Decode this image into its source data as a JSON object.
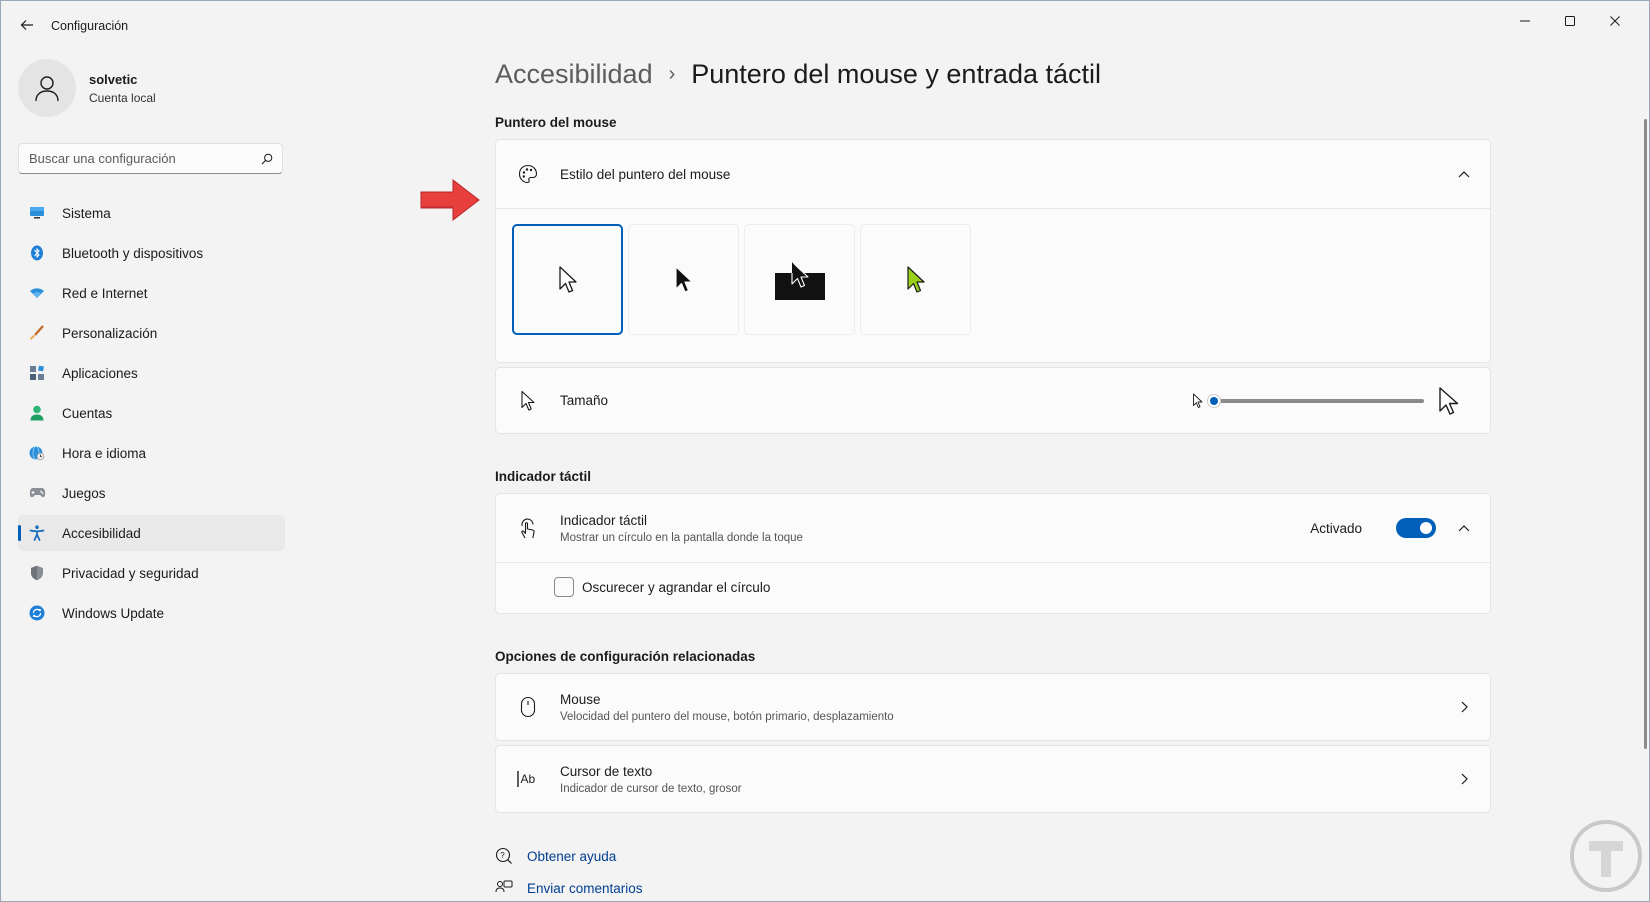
{
  "window": {
    "app_title": "Configuración",
    "icons": {
      "back": "back-arrow-icon",
      "minimize": "minimize-icon",
      "maximize": "maximize-icon",
      "close": "close-icon"
    }
  },
  "profile": {
    "name": "solvetic",
    "account": "Cuenta local",
    "icon": "user-avatar-icon"
  },
  "search": {
    "placeholder": "Buscar una configuración",
    "value": ""
  },
  "sidebar": {
    "items": [
      {
        "label": "Sistema",
        "icon": "monitor-icon",
        "active": false
      },
      {
        "label": "Bluetooth y dispositivos",
        "icon": "bluetooth-icon",
        "active": false
      },
      {
        "label": "Red e Internet",
        "icon": "wifi-icon",
        "active": false
      },
      {
        "label": "Personalización",
        "icon": "brush-icon",
        "active": false
      },
      {
        "label": "Aplicaciones",
        "icon": "apps-icon",
        "active": false
      },
      {
        "label": "Cuentas",
        "icon": "person-icon",
        "active": false
      },
      {
        "label": "Hora e idioma",
        "icon": "globe-clock-icon",
        "active": false
      },
      {
        "label": "Juegos",
        "icon": "gamepad-icon",
        "active": false
      },
      {
        "label": "Accesibilidad",
        "icon": "accessibility-icon",
        "active": true
      },
      {
        "label": "Privacidad y seguridad",
        "icon": "shield-icon",
        "active": false
      },
      {
        "label": "Windows Update",
        "icon": "update-icon",
        "active": false
      }
    ]
  },
  "breadcrumb": {
    "parent": "Accesibilidad",
    "separator": "›",
    "current": "Puntero del mouse y entrada táctil"
  },
  "mouse_pointer": {
    "section_title": "Puntero del mouse",
    "style": {
      "title": "Estilo del puntero del mouse",
      "icon": "palette-icon",
      "options": [
        "white",
        "black",
        "inverted",
        "custom"
      ],
      "selected": "white",
      "custom_color": "#9cd11a"
    },
    "size": {
      "title": "Tamaño",
      "icon": "pointer-icon",
      "level": 0
    }
  },
  "touch": {
    "section_title": "Indicador táctil",
    "title": "Indicador táctil",
    "subtitle": "Mostrar un círculo en la pantalla donde la toque",
    "icon": "touch-icon",
    "state_label": "Activado",
    "enabled": true,
    "checkbox_label": "Oscurecer y agrandar el círculo",
    "checkbox_checked": false
  },
  "related": {
    "section_title": "Opciones de configuración relacionadas",
    "items": [
      {
        "title": "Mouse",
        "subtitle": "Velocidad del puntero del mouse, botón primario, desplazamiento",
        "icon": "mouse-icon"
      },
      {
        "title": "Cursor de texto",
        "subtitle": "Indicador de cursor de texto, grosor",
        "icon": "text-cursor-icon"
      }
    ]
  },
  "footer": {
    "help": "Obtener ayuda",
    "feedback": "Enviar comentarios"
  },
  "colors": {
    "accent": "#005fb8",
    "annotation_arrow": "#e8403c",
    "link": "#003e92"
  }
}
